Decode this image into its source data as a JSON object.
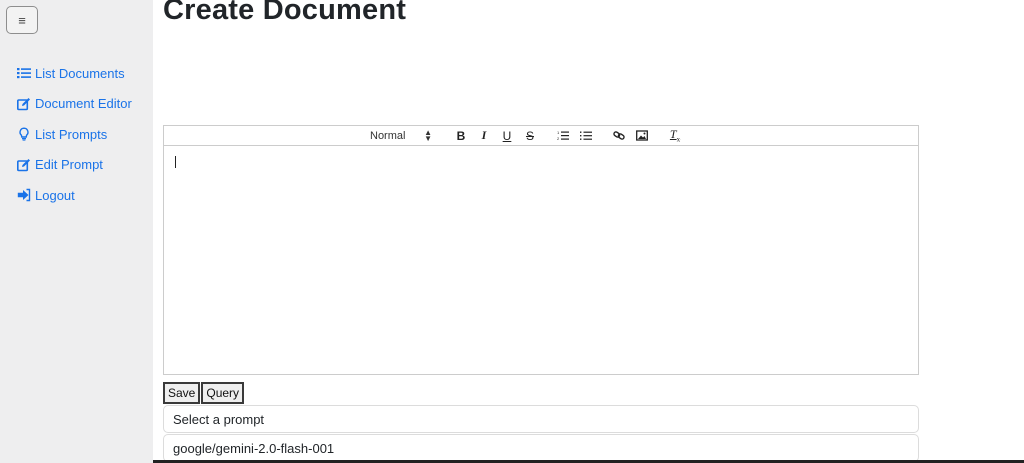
{
  "sidebar": {
    "toggle_icon": "hamburger-icon",
    "items": [
      {
        "label": "List Documents",
        "icon": "list-icon"
      },
      {
        "label": "Document Editor",
        "icon": "edit-icon"
      },
      {
        "label": "List Prompts",
        "icon": "lightbulb-icon"
      },
      {
        "label": "Edit Prompt",
        "icon": "edit-icon"
      },
      {
        "label": "Logout",
        "icon": "logout-icon"
      }
    ],
    "link_color": "#1a73e8"
  },
  "page": {
    "title": "Create Document"
  },
  "editor": {
    "heading_select": "Normal",
    "toolbar": [
      "bold",
      "italic",
      "underline",
      "strike",
      "ordered-list",
      "bullet-list",
      "link",
      "image",
      "clear-format"
    ],
    "content": ""
  },
  "actions": {
    "save_label": "Save",
    "query_label": "Query"
  },
  "selects": {
    "prompt": {
      "value": "Select a prompt"
    },
    "model": {
      "value": "google/gemini-2.0-flash-001"
    }
  }
}
